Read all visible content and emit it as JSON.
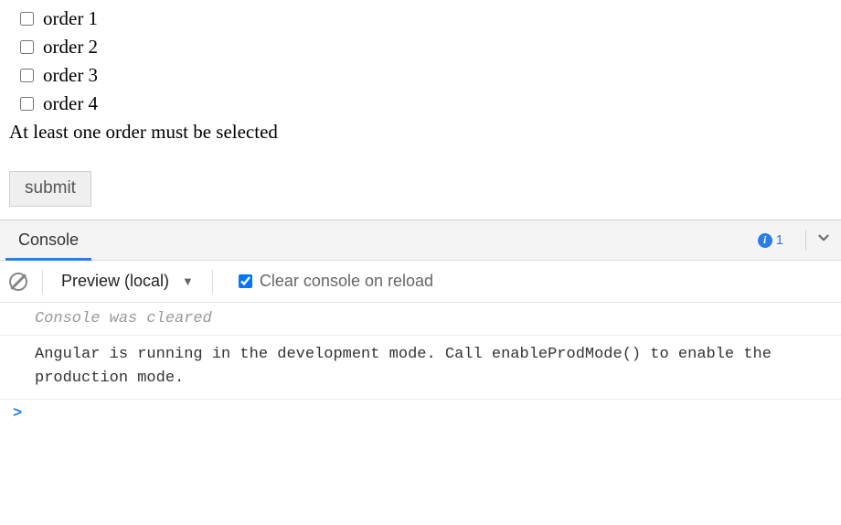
{
  "orders": [
    {
      "label": "order 1",
      "checked": false
    },
    {
      "label": "order 2",
      "checked": false
    },
    {
      "label": "order 3",
      "checked": false
    },
    {
      "label": "order 4",
      "checked": false
    }
  ],
  "validation_message": "At least one order must be selected",
  "submit_label": "submit",
  "devtools": {
    "tab_label": "Console",
    "info_count": "1",
    "context_label": "Preview (local)",
    "clear_on_reload_label": "Clear console on reload",
    "clear_on_reload_checked": true,
    "rows": {
      "cleared": "Console was cleared",
      "angular_msg": "Angular is running in the development mode. Call enableProdMode() to enable the production mode."
    },
    "prompt": ">"
  }
}
